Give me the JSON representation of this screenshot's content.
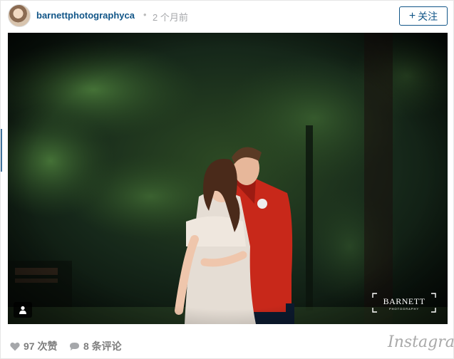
{
  "header": {
    "username": "barnettphotographyca",
    "separator": "•",
    "time_ago": "2 个月前",
    "follow_label": "关注",
    "follow_plus": "+"
  },
  "photo": {
    "watermark_main": "BARNETT",
    "watermark_sub": "PHOTOGRAPHY",
    "user_tag_icon": "person-icon"
  },
  "footer": {
    "likes": "97 次赞",
    "comments": "8 条评论",
    "brand": "Instagram"
  },
  "colors": {
    "link": "#125688",
    "muted": "#a5a7aa",
    "footer_text": "#7e7e7e"
  }
}
